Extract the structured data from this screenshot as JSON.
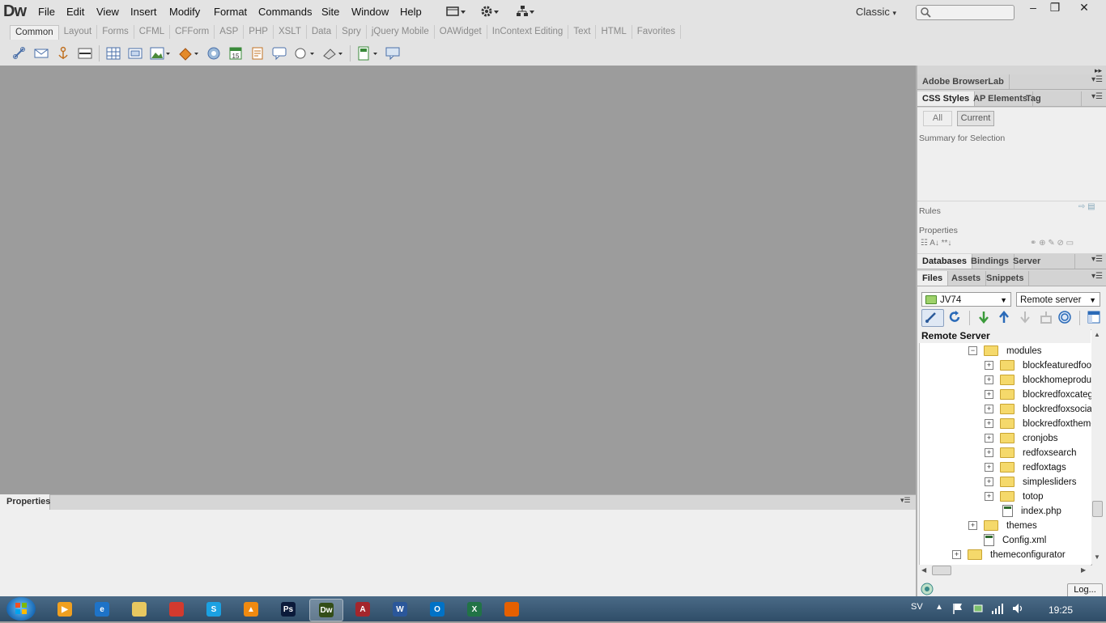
{
  "app": {
    "logo": "Dw",
    "menu": [
      "File",
      "Edit",
      "View",
      "Insert",
      "Modify",
      "Format",
      "Commands",
      "Site",
      "Window",
      "Help"
    ],
    "workspace": "Classic",
    "window_buttons": [
      "–",
      "❐",
      "✕"
    ]
  },
  "insert_bar": {
    "tabs": [
      "Common",
      "Layout",
      "Forms",
      "CFML",
      "CFForm",
      "ASP",
      "PHP",
      "XSLT",
      "Data",
      "Spry",
      "jQuery Mobile",
      "OAWidget",
      "InContext Editing",
      "Text",
      "HTML",
      "Favorites"
    ],
    "active_tab": "Common",
    "tools": [
      "hyperlink-icon",
      "email-link-icon",
      "named-anchor-icon",
      "horizontal-rule-icon",
      "table-icon",
      "insert-div-icon",
      "images-icon",
      "media-icon",
      "date-icon",
      "server-side-include-icon",
      "comment-icon",
      "head-icon",
      "script-icon",
      "templates-icon",
      "tag-chooser-icon",
      "widget-icon"
    ]
  },
  "properties_panel": {
    "title": "Properties"
  },
  "right_panel": {
    "browserlab": "Adobe BrowserLab",
    "css_tabs": [
      "CSS Styles",
      "AP Elements",
      "Tag Inspecto"
    ],
    "css_modes": [
      "All",
      "Current"
    ],
    "summary_label": "Summary for Selection",
    "rules_label": "Rules",
    "properties_label": "Properties",
    "db_tabs": [
      "Databases",
      "Bindings",
      "Server Behaviors"
    ],
    "files_tabs": [
      "Files",
      "Assets",
      "Snippets"
    ],
    "site_select": "JV74",
    "view_select": "Remote server",
    "tree_header": "Remote Server",
    "log_button": "Log..."
  },
  "file_tree": [
    {
      "name": "modules",
      "type": "folder",
      "depth": 1,
      "expanded": true
    },
    {
      "name": "blockfeaturedfoot",
      "type": "folder",
      "depth": 2,
      "expanded": false
    },
    {
      "name": "blockhomeproduct",
      "type": "folder",
      "depth": 2,
      "expanded": false
    },
    {
      "name": "blockredfoxcatego",
      "type": "folder",
      "depth": 2,
      "expanded": false
    },
    {
      "name": "blockredfoxsocial",
      "type": "folder",
      "depth": 2,
      "expanded": false
    },
    {
      "name": "blockredfoxtheme",
      "type": "folder",
      "depth": 2,
      "expanded": false
    },
    {
      "name": "cronjobs",
      "type": "folder",
      "depth": 2,
      "expanded": false
    },
    {
      "name": "redfoxsearch",
      "type": "folder",
      "depth": 2,
      "expanded": false
    },
    {
      "name": "redfoxtags",
      "type": "folder",
      "depth": 2,
      "expanded": false
    },
    {
      "name": "simplesliders",
      "type": "folder",
      "depth": 2,
      "expanded": false
    },
    {
      "name": "totop",
      "type": "folder",
      "depth": 2,
      "expanded": false
    },
    {
      "name": "index.php",
      "type": "file",
      "depth": 2
    },
    {
      "name": "themes",
      "type": "folder",
      "depth": 1,
      "expanded": false
    },
    {
      "name": "Config.xml",
      "type": "file",
      "depth": 1
    },
    {
      "name": "themeconfigurator",
      "type": "folder",
      "depth": 0,
      "expanded": false
    }
  ],
  "taskbar": {
    "apps": [
      {
        "name": "media-player",
        "label": "▶",
        "color": "#f0a020"
      },
      {
        "name": "internet-explorer",
        "label": "e",
        "color": "#1e73c8"
      },
      {
        "name": "file-explorer",
        "label": "",
        "color": "#e8c860"
      },
      {
        "name": "chrome",
        "label": "",
        "color": "#d23a2e"
      },
      {
        "name": "skype",
        "label": "S",
        "color": "#1ba1e2"
      },
      {
        "name": "vlc",
        "label": "▲",
        "color": "#f08a10"
      },
      {
        "name": "photoshop",
        "label": "Ps",
        "color": "#0b1a3a"
      },
      {
        "name": "dreamweaver",
        "label": "Dw",
        "color": "#334d18"
      },
      {
        "name": "access",
        "label": "A",
        "color": "#a4262c"
      },
      {
        "name": "word",
        "label": "W",
        "color": "#2b579a"
      },
      {
        "name": "outlook",
        "label": "O",
        "color": "#0072c6"
      },
      {
        "name": "excel",
        "label": "X",
        "color": "#217346"
      },
      {
        "name": "firefox",
        "label": "",
        "color": "#e66000"
      }
    ],
    "active_app": "dreamweaver",
    "language": "SV",
    "time": "19:25"
  }
}
